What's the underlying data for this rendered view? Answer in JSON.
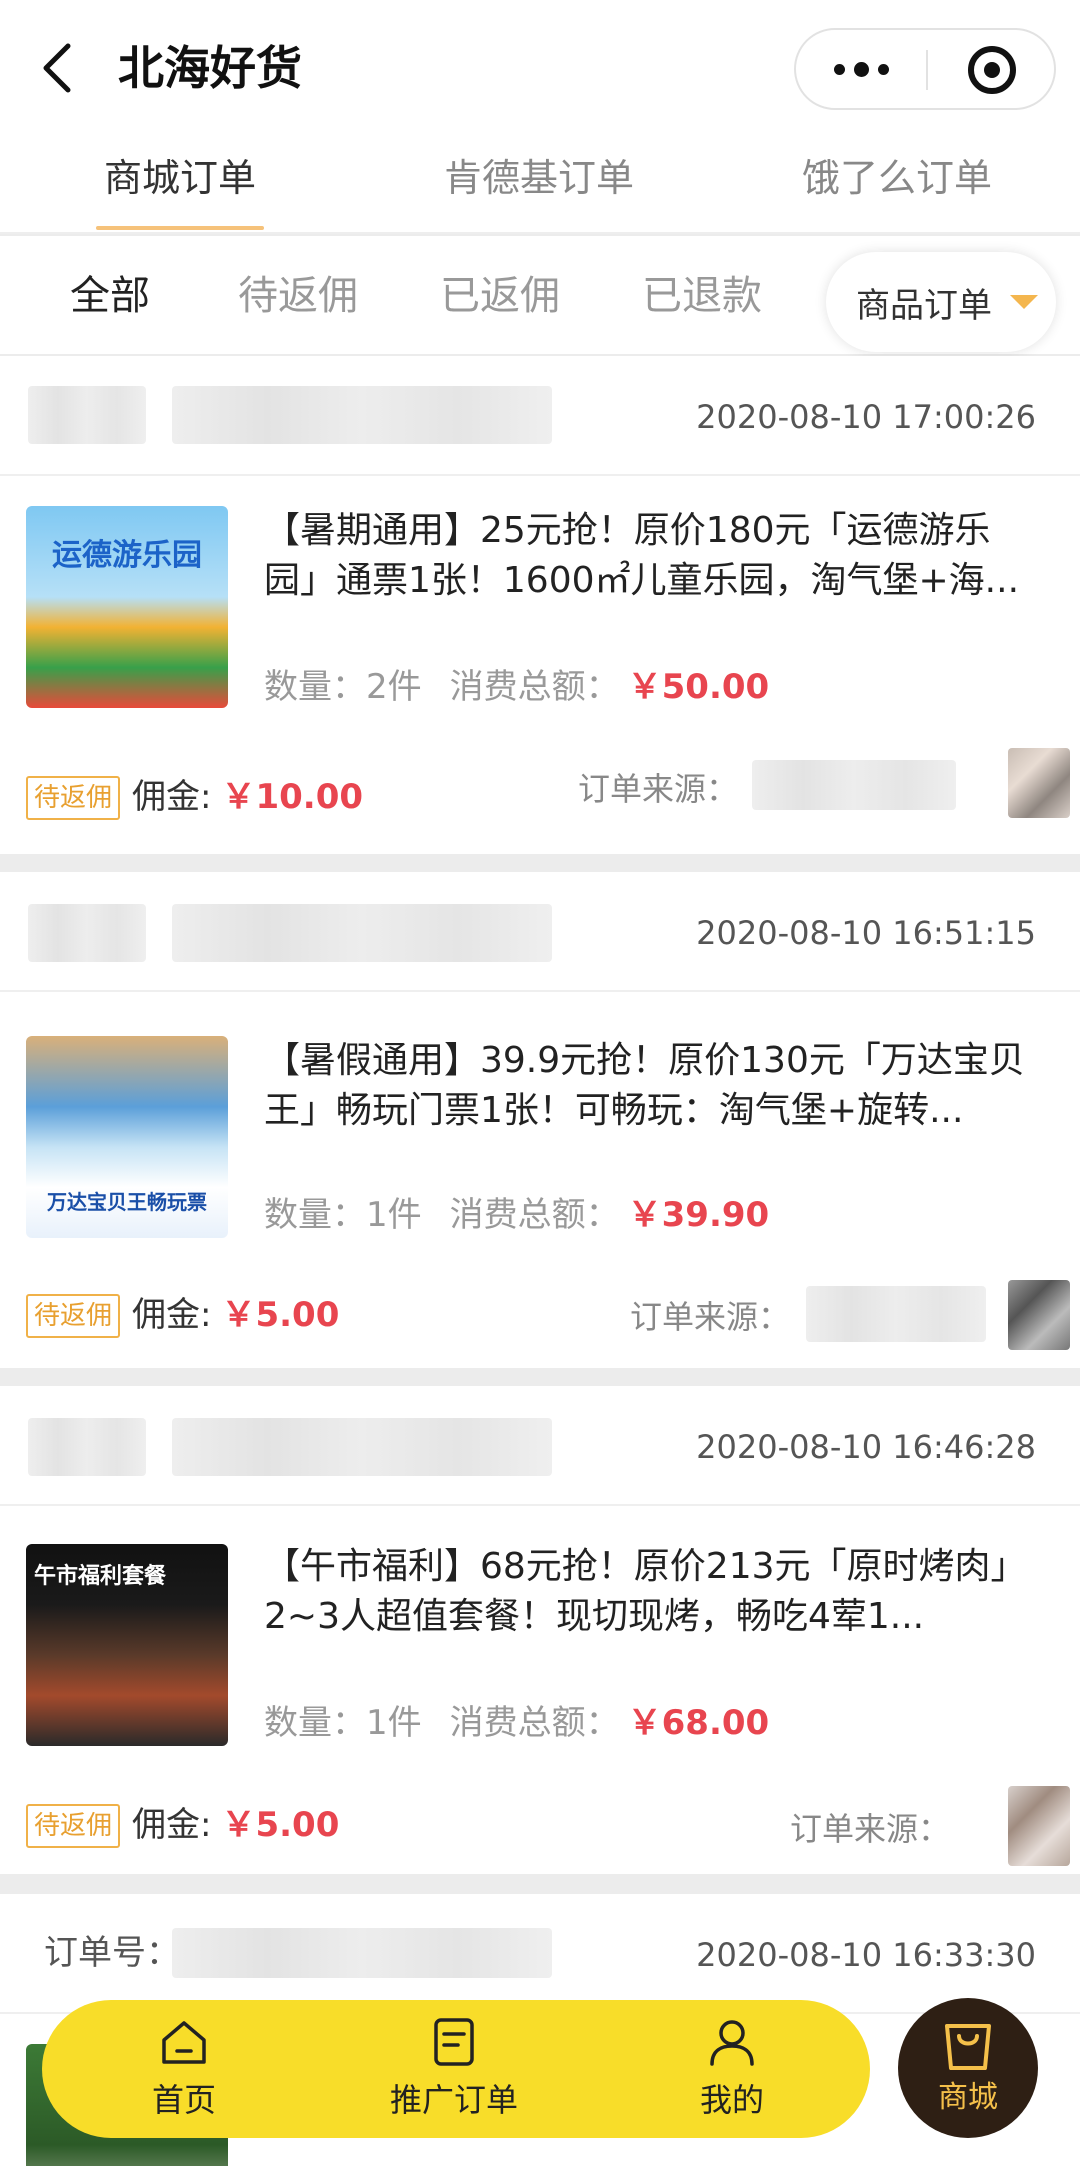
{
  "header": {
    "title": "北海好货"
  },
  "tabs": [
    {
      "label": "商城订单"
    },
    {
      "label": "肯德基订单"
    },
    {
      "label": "饿了么订单"
    }
  ],
  "filters": [
    {
      "label": "全部"
    },
    {
      "label": "待返佣"
    },
    {
      "label": "已返佣"
    },
    {
      "label": "已退款"
    }
  ],
  "dropdown": {
    "label": "商品订单"
  },
  "orders": [
    {
      "time": "2020-08-10 17:00:26",
      "thumb_title": "运德游乐园",
      "name": "【暑期通用】25元抢！原价180元「运德游乐园」通票1张！1600㎡儿童乐园，淘气堡+海...",
      "quantity_label": "数量：2件",
      "total_label": "消费总额：",
      "total": "￥50.00",
      "badge": "待返佣",
      "commission_label": "佣金:",
      "commission": "￥10.00",
      "source_label": "订单来源："
    },
    {
      "time": "2020-08-10 16:51:15",
      "thumb_title": "万达宝贝王畅玩票",
      "name": "【暑假通用】39.9元抢！原价130元「万达宝贝王」畅玩门票1张！可畅玩：淘气堡+旋转...",
      "quantity_label": "数量：1件",
      "total_label": "消费总额：",
      "total": "￥39.90",
      "badge": "待返佣",
      "commission_label": "佣金:",
      "commission": "￥5.00",
      "source_label": "订单来源："
    },
    {
      "time": "2020-08-10 16:46:28",
      "thumb_title": "午市福利套餐",
      "name": "【午市福利】68元抢！原价213元「原时烤肉」2~3人超值套餐！现切现烤，畅吃4荤1...",
      "quantity_label": "数量：1件",
      "total_label": "消费总额：",
      "total": "￥68.00",
      "badge": "待返佣",
      "commission_label": "佣金:",
      "commission": "￥5.00",
      "source_label": "订单来源："
    },
    {
      "order_no_label": "订单号：",
      "time": "2020-08-10 16:33:30"
    }
  ],
  "bottom_nav": {
    "items": [
      {
        "label": "首页",
        "icon": "home-icon"
      },
      {
        "label": "推广订单",
        "icon": "order-icon"
      },
      {
        "label": "我的",
        "icon": "user-icon"
      }
    ],
    "mall": {
      "label": "商城",
      "icon": "shopping-bag-icon"
    }
  }
}
